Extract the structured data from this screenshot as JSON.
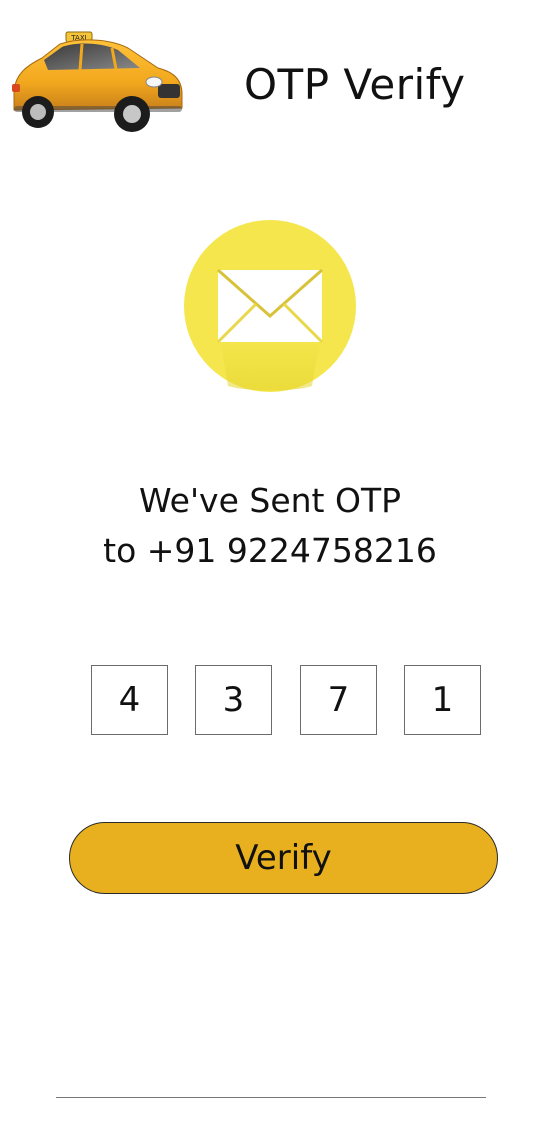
{
  "header": {
    "title": "OTP Verify",
    "logo_text": "TAXI"
  },
  "message": {
    "line1": "We've Sent OTP",
    "line2": "to +91 9224758216"
  },
  "otp": {
    "digits": [
      "4",
      "3",
      "7",
      "1"
    ]
  },
  "actions": {
    "verify_label": "Verify"
  },
  "colors": {
    "accent": "#e8b01f",
    "mail_badge": "#f4e64c",
    "taxi_body": "#f2a81d"
  },
  "icons": {
    "logo": "taxi-car-icon",
    "mail": "envelope-icon"
  }
}
